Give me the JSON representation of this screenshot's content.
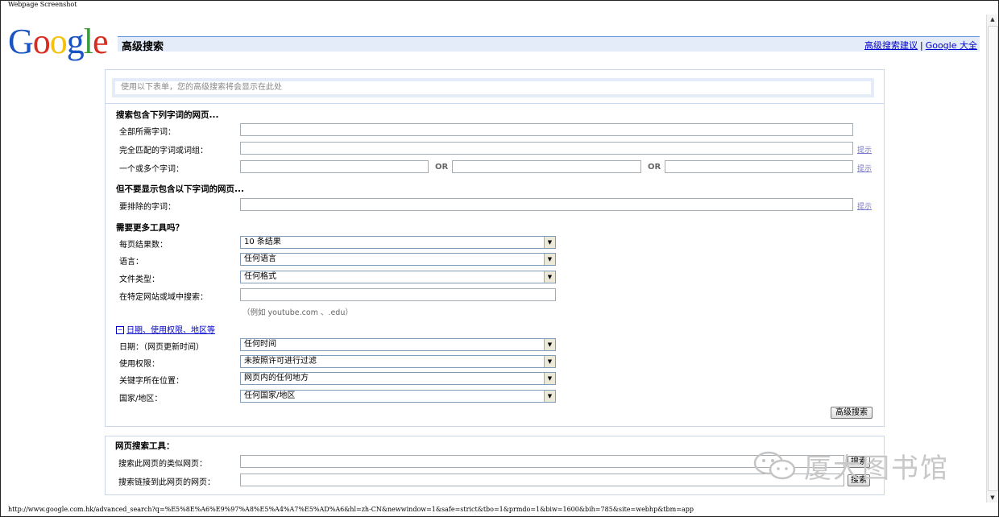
{
  "caption": "Webpage Screenshot",
  "logo": {
    "letters": [
      "G",
      "o",
      "o",
      "g",
      "l",
      "e"
    ],
    "colors": [
      "#1a53c4",
      "#d62d20",
      "#f4c20d",
      "#1a53c4",
      "#3a9c3a",
      "#d62d20"
    ]
  },
  "header": {
    "title": "高级搜索",
    "link_tips": "高级搜索建议",
    "link_sep": "|",
    "link_all": "Google 大全"
  },
  "preview": {
    "placeholder": "使用以下表单，您的高级搜索将会显示在此处"
  },
  "find": {
    "title": "搜索包含下列字词的网页...",
    "all_words": "全部所需字词：",
    "exact": "完全匹配的字词或词组：",
    "any": "一个或多个字词：",
    "or1": "OR",
    "or2": "OR",
    "hint": "提示"
  },
  "exclude": {
    "title": "但不要显示包含以下字词的网页...",
    "label": "要排除的字词：",
    "hint": "提示"
  },
  "more": {
    "title": "需要更多工具吗？",
    "results_label": "每页结果数：",
    "results_value": "10 条结果",
    "lang_label": "语言：",
    "lang_value": "任何语言",
    "file_label": "文件类型：",
    "file_value": "任何格式",
    "site_label": "在特定网站或域中搜索：",
    "site_note": "（例如 youtube.com 、.edu）",
    "expander": "日期、使用权限、地区等",
    "expander_box": "−",
    "date_label": "日期：（网页更新时间）",
    "date_value": "任何时间",
    "rights_label": "使用权限：",
    "rights_value": "未按照许可进行过滤",
    "where_label": "关键字所在位置：",
    "where_value": "网页内的任何地方",
    "region_label": "国家/地区：",
    "region_value": "任何国家/地区",
    "submit": "高级搜索"
  },
  "tools": {
    "title": "网页搜索工具：",
    "similar_label": "搜索此网页的类似网页：",
    "links_label": "搜索链接到此网页的网页：",
    "btn1": "搜索",
    "btn2": "搜索"
  },
  "watermark": {
    "text": "厦大图书馆"
  },
  "status": {
    "url": "http://www.google.com.hk/advanced_search?q=%E5%8E%A6%E9%97%A8%E5%A4%A7%E5%AD%A6&hl=zh-CN&newwindow=1&safe=strict&tbo=1&prmdo=1&biw=1600&bih=785&site=webhp&tbm=app"
  }
}
